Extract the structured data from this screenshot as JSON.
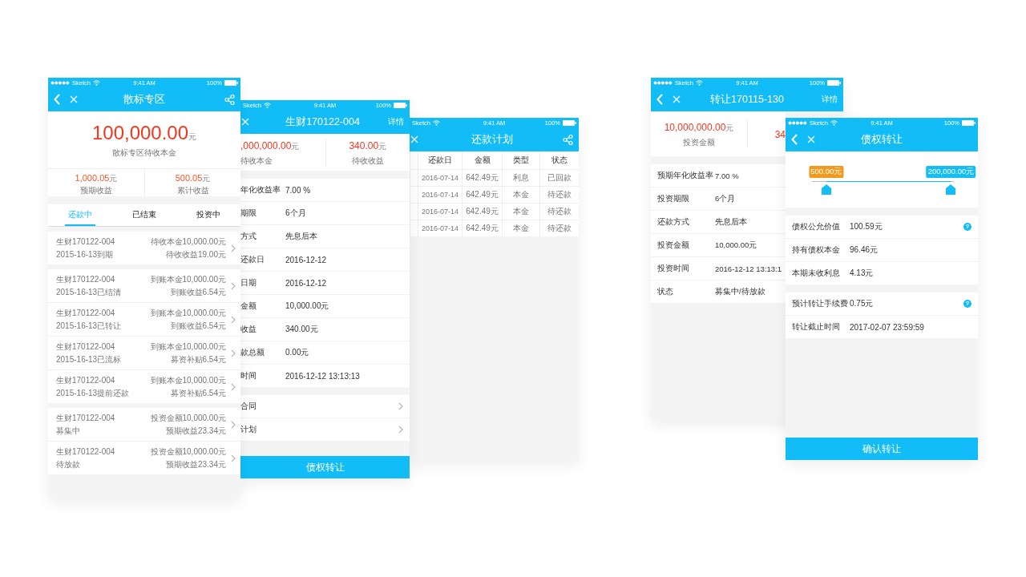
{
  "screens": [
    {
      "kind": "portfolio",
      "status": {
        "signal": true,
        "carrier": "Sketch",
        "time": "9:41 AM",
        "battery": "100%"
      },
      "back": true,
      "close": true,
      "share": true,
      "title": "散标专区",
      "principal": {
        "amount": "100,000.00",
        "unit": "元",
        "label": "散标专区待收本金"
      },
      "stats": [
        {
          "amount": "1,000.05",
          "unit": "元",
          "label": "预期收益"
        },
        {
          "amount": "500.05",
          "unit": "元",
          "label": "累计收益"
        }
      ],
      "tabs": [
        {
          "label": "还款中",
          "selected": true
        },
        {
          "label": "已结束",
          "selected": false
        },
        {
          "label": "投资中",
          "selected": false
        }
      ],
      "sections": [
        {
          "items": [
            {
              "title": "生财170122-004",
              "subtitle": "2015-16-13到期",
              "line_1": "待收本金10,000.00元",
              "line_2": "待收收益19.00元"
            }
          ]
        },
        {
          "items": [
            {
              "title": "生财170122-004",
              "subtitle": "2015-16-13已结清",
              "line_1": "到账本金10,000.00元",
              "line_2": "到账收益6.54元"
            },
            {
              "title": "生财170122-004",
              "subtitle": "2015-16-13已转让",
              "line_1": "到账本金10,000.00元",
              "line_2": "到账收益6.54元"
            },
            {
              "title": "生财170122-004",
              "subtitle": "2015-16-13已流标",
              "line_1": "到账本金10,000.00元",
              "line_2": "募资补贴6.54元"
            },
            {
              "title": "生财170122-004",
              "subtitle": "2015-16-13提前还款",
              "line_1": "到账本金10,000.00元",
              "line_2": "募资补贴6.54元"
            }
          ]
        },
        {
          "items": [
            {
              "title": "生财170122-004",
              "subtitle": "募集中",
              "line_1": "投资金额10,000.00元",
              "line_2": "预期收益23.34元"
            },
            {
              "title": "生财170122-004",
              "subtitle": "待放款",
              "line_1": "投资金额10,000.00元",
              "line_2": "预期收益23.34元"
            }
          ]
        }
      ]
    },
    {
      "kind": "loan_detail",
      "status": {
        "signal": false,
        "carrier": "Sketch",
        "time": "9:41 AM",
        "battery": "100%"
      },
      "back": false,
      "close": true,
      "share": false,
      "action": "详情",
      "title": "生财170122-004",
      "summary": [
        {
          "amount": ",000,000.00",
          "unit": "元",
          "label": "待收本金"
        },
        {
          "amount": "340.00",
          "unit": "元",
          "label": "待收收益"
        }
      ],
      "fields": [
        {
          "label": "年化收益率",
          "value": "7.00 %"
        },
        {
          "label": "期限",
          "value": "6个月"
        },
        {
          "label": "方式",
          "value": "先息后本"
        },
        {
          "label": "还款日",
          "value": "2016-12-12"
        },
        {
          "label": "日期",
          "value": "2016-12-12"
        },
        {
          "label": "金额",
          "value": "10,000.00元"
        },
        {
          "label": "收益",
          "value": "340.00元"
        },
        {
          "label": "款总额",
          "value": "0.00元"
        },
        {
          "label": "时间",
          "value": "2016-12-12 13:13:13"
        }
      ],
      "links": [
        {
          "label": "合同"
        },
        {
          "label": "计划"
        }
      ],
      "button": "债权转让"
    },
    {
      "kind": "schedule",
      "status": {
        "signal": false,
        "carrier": "Sketch",
        "time": "9:41 AM",
        "battery": "100%"
      },
      "back": false,
      "close": true,
      "share": true,
      "title": "还款计划",
      "table": {
        "columns": [
          "还款日",
          "金额",
          "类型",
          "状态"
        ],
        "rows": [
          [
            "2016-07-14",
            "642.49元",
            "利息",
            "已回款"
          ],
          [
            "2016-07-14",
            "642.49元",
            "本金",
            "待还款"
          ],
          [
            "2016-07-14",
            "642.49元",
            "本金",
            "待还款"
          ],
          [
            "2016-07-14",
            "642.49元",
            "本金",
            "待还款"
          ]
        ]
      }
    },
    {
      "kind": "transfer_detail",
      "status": {
        "signal": true,
        "carrier": "Sketch",
        "time": "9:41 AM",
        "battery": "100%"
      },
      "back": true,
      "close": true,
      "share": false,
      "action": "详情",
      "title": "转让170115-130",
      "summary": [
        {
          "amount": "10,000,000.00",
          "unit": "元",
          "label": "投资金额"
        },
        {
          "amount": "34"
        }
      ],
      "fields": [
        {
          "label": "预期年化收益率",
          "value": "7.00 %"
        },
        {
          "label": "投资期限",
          "value": "6个月"
        },
        {
          "label": "还款方式",
          "value": "先息后本"
        },
        {
          "label": "投资金额",
          "value": "10,000.00元"
        },
        {
          "label": "投资时间",
          "value": "2016-12-12 13:13:1"
        },
        {
          "label": "状态",
          "value": "募集中/待放款"
        }
      ]
    },
    {
      "kind": "transfer",
      "status": {
        "signal": true,
        "carrier": "Sketch",
        "time": "9:41 AM",
        "battery": "100%"
      },
      "back": true,
      "close": true,
      "share": false,
      "title": "债权转让",
      "range": {
        "handles": [
          {
            "label": "500.00元",
            "level": 0.1,
            "color": "#f39a1e"
          },
          {
            "label": "200,000.00元",
            "level": 0.98,
            "color": "#14bdf5"
          }
        ]
      },
      "sections": [
        {
          "fields": [
            {
              "label": "债权公允价值",
              "value": "100.59元",
              "help": "?"
            },
            {
              "label": "持有债权本金",
              "value": "96.46元"
            },
            {
              "label": "本期未收利息",
              "value": "4.13元"
            }
          ]
        },
        {
          "fields": [
            {
              "label": "预计转让手续费",
              "value": "0.75元",
              "help": "?"
            },
            {
              "label": "转让截止时间",
              "value": "2017-02-07  23:59:59"
            }
          ]
        }
      ],
      "button": "确认转让"
    }
  ]
}
